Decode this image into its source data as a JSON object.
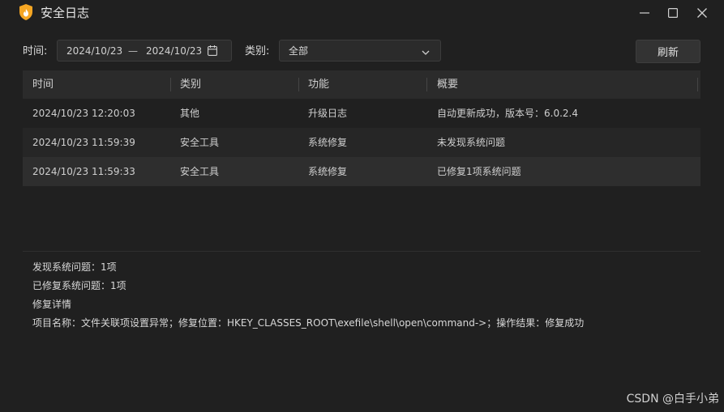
{
  "window": {
    "title": "安全日志"
  },
  "filters": {
    "time_label": "时间:",
    "date_start": "2024/10/23",
    "date_separator": "—",
    "date_end": "2024/10/23",
    "category_label": "类别:",
    "category_value": "全部",
    "refresh_label": "刷新"
  },
  "table": {
    "columns": [
      "时间",
      "类别",
      "功能",
      "概要"
    ],
    "rows": [
      [
        "2024/10/23 12:20:03",
        "其他",
        "升级日志",
        "自动更新成功，版本号：6.0.2.4"
      ],
      [
        "2024/10/23 11:59:39",
        "安全工具",
        "系统修复",
        "未发现系统问题"
      ],
      [
        "2024/10/23 11:59:33",
        "安全工具",
        "系统修复",
        "已修复1项系统问题"
      ]
    ],
    "selected_row": 2
  },
  "details": {
    "lines": [
      "发现系统问题：1项",
      "已修复系统问题：1项",
      "修复详情",
      "项目名称：文件关联项设置异常；修复位置：HKEY_CLASSES_ROOT\\exefile\\shell\\open\\command->；操作结果：修复成功"
    ]
  },
  "watermark": "CSDN @白手小弟",
  "colors": {
    "background": "#202020",
    "header": "#2b2b2b",
    "selected_row": "#2e2e2e",
    "shield_orange": "#f5a623"
  },
  "icons": {
    "app": "shield-flame-icon",
    "calendar": "calendar-icon",
    "dropdown": "chevron-down-icon",
    "minimize": "minimize-icon",
    "maximize": "maximize-icon",
    "close": "close-icon"
  }
}
